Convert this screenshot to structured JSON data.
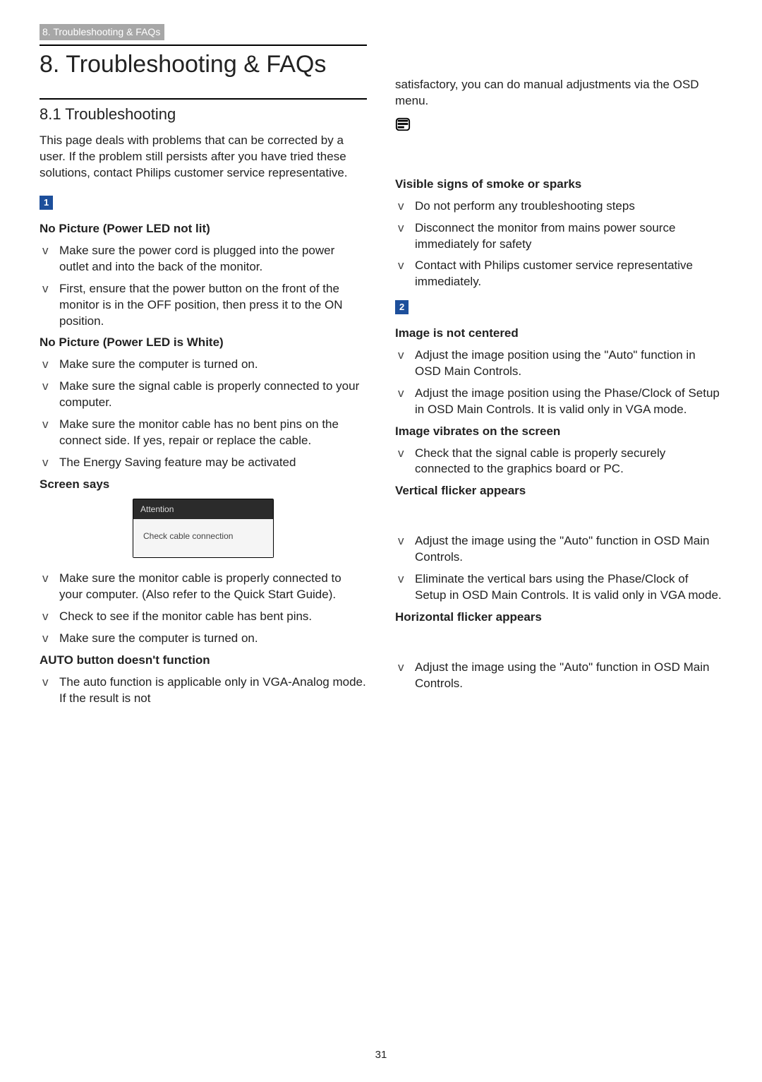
{
  "running_header": "8. Troubleshooting & FAQs",
  "chapter_title": "8.  Troubleshooting & FAQs",
  "subchapter_title": "8.1  Troubleshooting",
  "intro": "This page deals with problems that can be corrected by a user. If the problem still persists after you have tried these solutions, contact Philips customer service representative.",
  "badge1": "1",
  "badge2": "2",
  "left": {
    "t1": "No Picture (Power LED not lit)",
    "t1_items": [
      "Make sure the power cord is plugged into the power outlet and into the back of the monitor.",
      "First, ensure that the power button on the front of the monitor is in the OFF position, then press it to the ON position."
    ],
    "t2": "No Picture (Power LED is White)",
    "t2_items": [
      "Make sure the computer is turned on.",
      "Make sure the signal cable is properly connected to your computer.",
      "Make sure the monitor cable has no bent pins on the connect side. If yes, repair or replace the cable.",
      "The Energy Saving feature may be activated"
    ],
    "t3": "Screen says",
    "screen_hdr": "Attention",
    "screen_body": "Check cable connection",
    "t3_items": [
      "Make sure the monitor cable is properly connected to your computer. (Also refer to the Quick Start Guide).",
      "Check to see if the monitor cable has bent pins.",
      "Make sure the computer is turned on."
    ],
    "t4": "AUTO button doesn't function",
    "t4_items": [
      "The auto function is applicable only in VGA-Analog mode.  If the result is not"
    ]
  },
  "right": {
    "cont": "satisfactory, you can do manual adjustments via the OSD menu.",
    "t5": "Visible signs of smoke or sparks",
    "t5_items": [
      "Do not perform any troubleshooting steps",
      "Disconnect the monitor from mains power source immediately for safety",
      "Contact with Philips customer service representative immediately."
    ],
    "t6": "Image is not centered",
    "t6_items": [
      "Adjust the image position using the \"Auto\" function in OSD Main Controls.",
      "Adjust the image position using the Phase/Clock of Setup in OSD Main Controls.  It is valid only in VGA mode."
    ],
    "t7": "Image vibrates on the screen",
    "t7_items": [
      "Check that the signal cable is properly securely connected to the graphics board or PC."
    ],
    "t8": "Vertical flicker appears",
    "t8_items": [
      "Adjust the image using the \"Auto\" function in OSD Main Controls.",
      "Eliminate the vertical bars using the Phase/Clock of Setup in OSD Main Controls. It is valid only in VGA mode."
    ],
    "t9": "Horizontal flicker appears",
    "t9_items": [
      "Adjust the image using the \"Auto\" function in OSD Main Controls."
    ]
  },
  "page_number": "31"
}
